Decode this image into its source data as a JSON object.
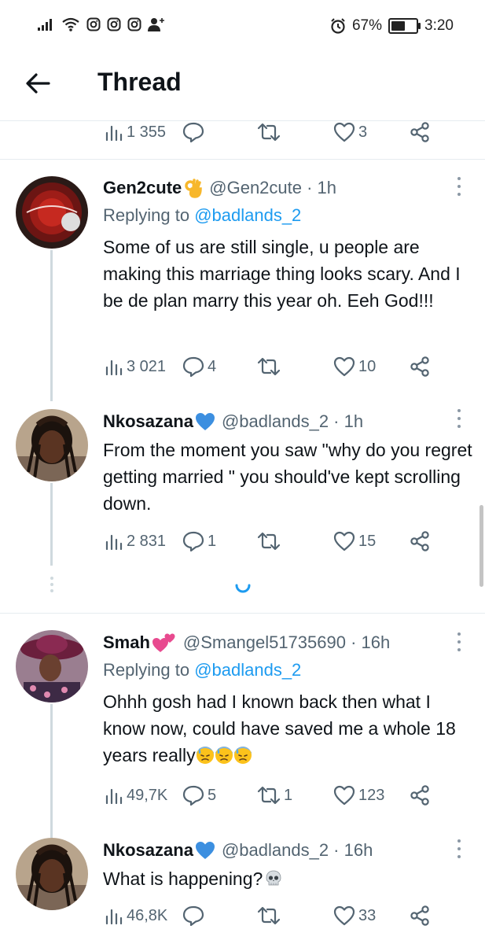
{
  "status_bar": {
    "battery": "67%",
    "battery_level": 0.67,
    "time": "3:20",
    "icons": [
      "signal-icon",
      "wifi-icon",
      "instagram-icon",
      "instagram-icon",
      "instagram-icon",
      "add-user-icon",
      "alarm-icon",
      "battery-icon"
    ]
  },
  "header": {
    "title": "Thread",
    "back_icon": "arrow-left-icon"
  },
  "colors": {
    "link": "#1d9bf0",
    "muted": "#536471",
    "text": "#0f1419",
    "divider": "#e6ecf0"
  },
  "top_actions": {
    "views": "1 355",
    "replies": "",
    "retweets": "",
    "likes": "3"
  },
  "tweets": [
    {
      "name": "Gen2cute",
      "name_emoji": "ok-hand-emoji",
      "handle": "@Gen2cute · 1h",
      "replying_prefix": "Replying to ",
      "replying_to": "@badlands_2",
      "text": "Some of us are still single, u people are making this marriage thing looks scary. And I be de plan marry this year oh. Eeh God!!!",
      "views": "3 021",
      "replies": "4",
      "retweets": "",
      "likes": "10"
    },
    {
      "name": "Nkosazana",
      "name_emoji": "blue-heart-emoji",
      "handle": "@badlands_2 · 1h",
      "text": "From the moment you saw \"why do you regret getting married \" you should've kept scrolling down.",
      "views": "2 831",
      "replies": "1",
      "retweets": "",
      "likes": "15"
    },
    {
      "name": "Smah",
      "name_emoji": "two-hearts-emoji",
      "handle": "@Smangel51735690 · 16h",
      "replying_prefix": "Replying to ",
      "replying_to": "@badlands_2",
      "text": "Ohhh gosh had I known back then what I know now, could have saved me a whole 18 years really",
      "text_emojis": [
        "downcast-sweat-emoji",
        "downcast-sweat-emoji",
        "downcast-sweat-emoji"
      ],
      "views": "49,7K",
      "replies": "5",
      "retweets": "1",
      "likes": "123"
    },
    {
      "name": "Nkosazana",
      "name_emoji": "blue-heart-emoji",
      "handle": "@badlands_2 · 16h",
      "text": "What is happening?",
      "text_emojis": [
        "skull-emoji"
      ],
      "views": "46,8K",
      "replies": "",
      "retweets": "",
      "likes": "33"
    }
  ]
}
